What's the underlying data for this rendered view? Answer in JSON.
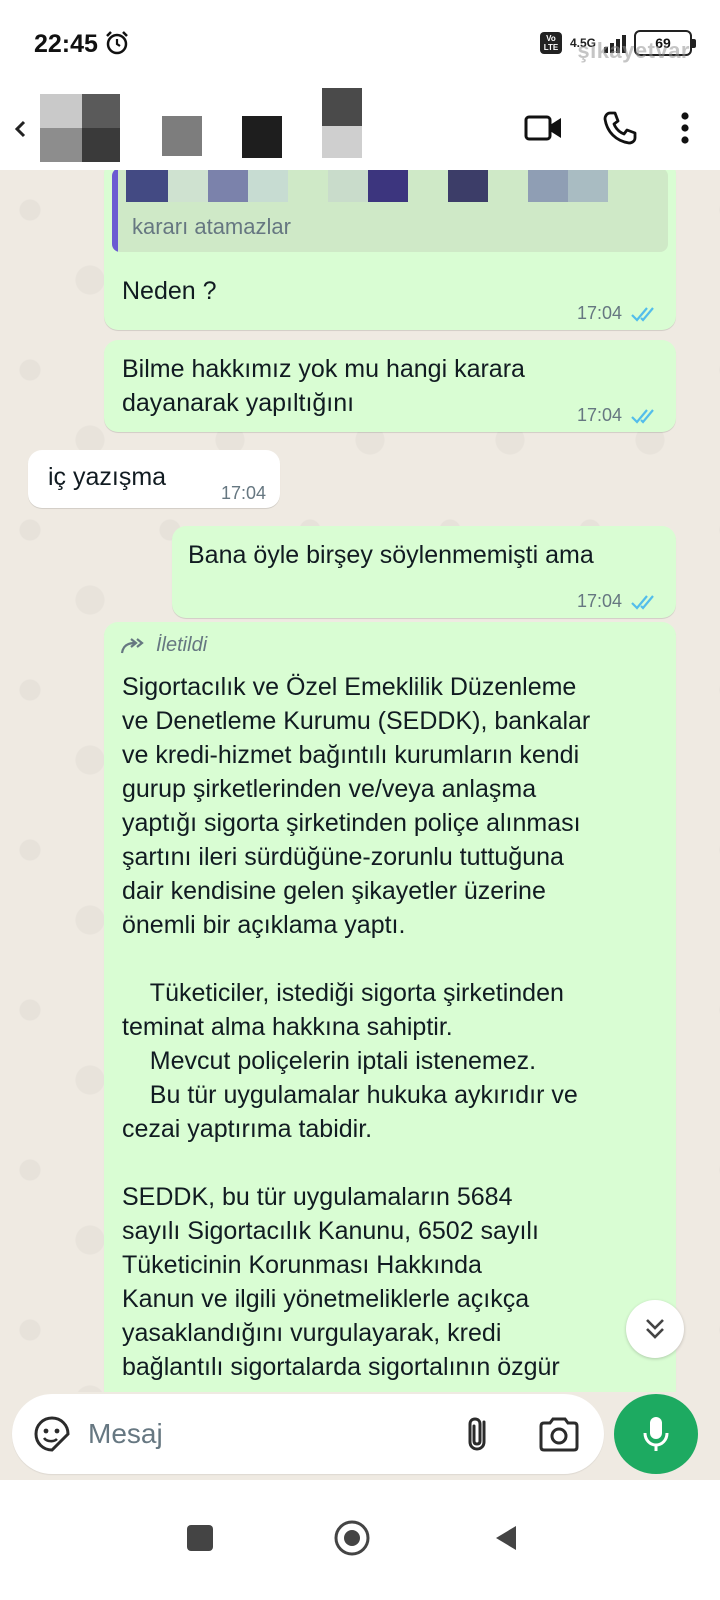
{
  "status_bar": {
    "time": "22:45",
    "network": "4.5G",
    "volte": "Vo LTE",
    "battery": "69",
    "watermark": "şikayetvar"
  },
  "header": {
    "icons": [
      "back-icon",
      "video-call-icon",
      "voice-call-icon",
      "more-options-icon"
    ]
  },
  "messages": [
    {
      "direction": "out",
      "quoted": "kararı atamazlar",
      "text": "Neden ?",
      "time": "17:04",
      "status": "read"
    },
    {
      "direction": "out",
      "text": "Bilme hakkımız yok mu hangi karara\ndayanarak yapıltığını",
      "time": "17:04",
      "status": "read"
    },
    {
      "direction": "in",
      "text": "iç yazışma",
      "time": "17:04"
    },
    {
      "direction": "out",
      "text": "Bana öyle birşey söylenmemişti ama",
      "time": "17:04",
      "status": "read"
    },
    {
      "direction": "out",
      "forwarded_label": "İletildi",
      "text": "Sigortacılık ve Özel Emeklilik Düzenleme\nve Denetleme Kurumu (SEDDK), bankalar\nve kredi-hizmet bağıntılı kurumların kendi\ngurup şirketlerinden ve/veya anlaşma\nyaptığı sigorta şirketinden poliçe alınması\nşartını ileri sürdüğüne-zorunlu tuttuğuna\ndair kendisine gelen şikayetler üzerine\nönemli bir açıklama yaptı.\n\n    Tüketiciler, istediği sigorta şirketinden\nteminat alma hakkına sahiptir.\n    Mevcut poliçelerin iptali istenemez.\n    Bu tür uygulamalar hukuka aykırıdır ve\ncezai yaptırıma tabidir.\n\nSEDDK, bu tür uygulamaların 5684\nsayılı Sigortacılık Kanunu, 6502 sayılı\nTüketicinin Korunması Hakkında\nKanun ve ilgili yönetmeliklerle açıkça\nyasaklandığını vurgulayarak, kredi\nbağlantılı sigortalarda sigortalının özgür"
    }
  ],
  "input": {
    "placeholder": "Mesaj"
  },
  "colors": {
    "outgoing_bubble": "#d9fdd3",
    "incoming_bubble": "#ffffff",
    "chat_background": "#efeae2",
    "read_tick": "#53bdeb",
    "mic_button": "#1daa61",
    "quote_bar": "#6b5bd2"
  }
}
